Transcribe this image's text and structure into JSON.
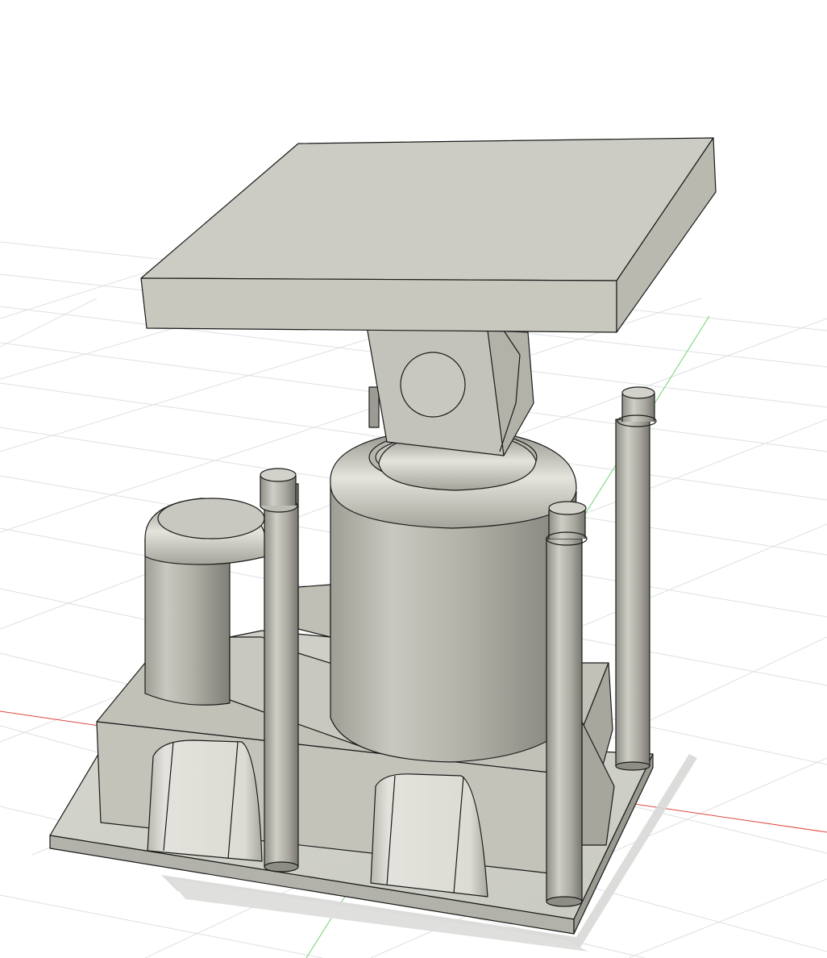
{
  "viewport": {
    "background": "#ffffff",
    "grid_line_color": "#d9dcdf",
    "grid_major_color": "#c4c8cc",
    "x_axis_color": "#e0473f",
    "y_axis_color": "#6fd36f"
  },
  "model": {
    "body_color": "#bdbcb3",
    "edge_color": "#1a1a1a",
    "shadow_color": "#dcdcdc",
    "parts": [
      "base-plate",
      "base-block",
      "tall-cylinder",
      "small-cylinder",
      "pillars",
      "joint-housing",
      "top-platform"
    ]
  }
}
